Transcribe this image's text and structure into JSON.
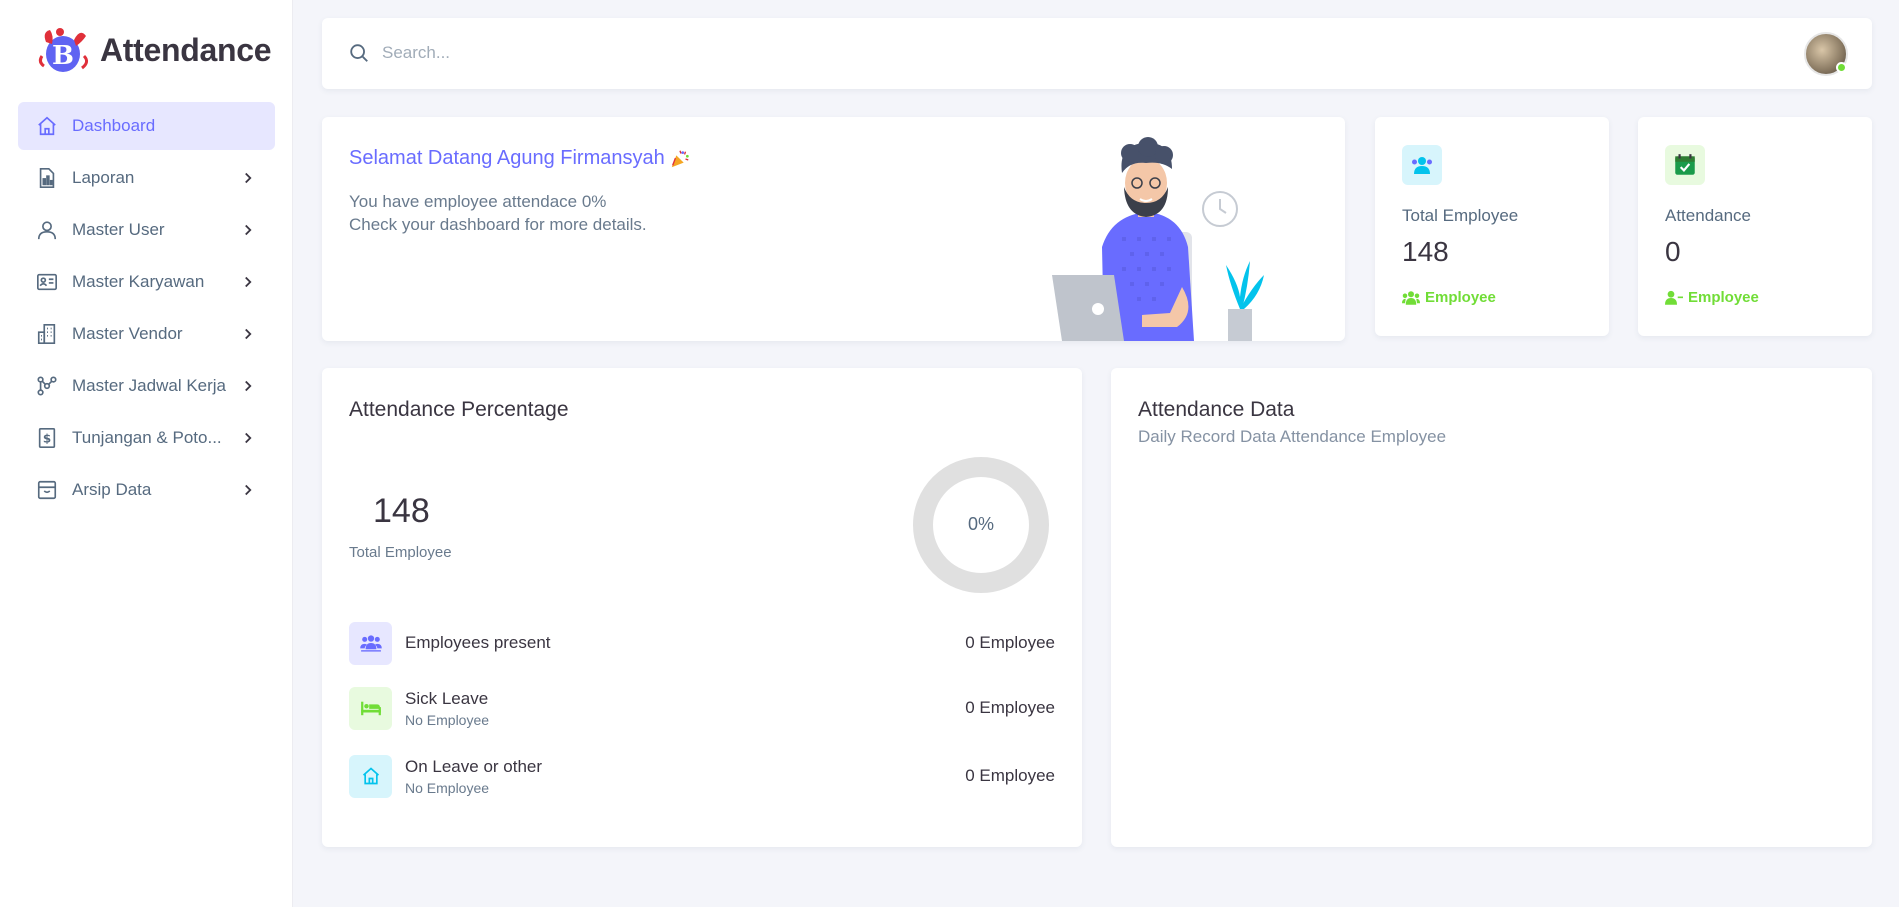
{
  "brand": {
    "title": "Attendance",
    "logo_letter": "B"
  },
  "sidebar": {
    "items": [
      {
        "label": "Dashboard",
        "icon": "home-icon",
        "active": true
      },
      {
        "label": "Laporan",
        "icon": "report-icon"
      },
      {
        "label": "Master User",
        "icon": "user-icon"
      },
      {
        "label": "Master Karyawan",
        "icon": "id-card-icon"
      },
      {
        "label": "Master Vendor",
        "icon": "building-icon"
      },
      {
        "label": "Master Jadwal Kerja",
        "icon": "network-icon"
      },
      {
        "label": "Tunjangan & Poto...",
        "icon": "dollar-receipt-icon"
      },
      {
        "label": "Arsip Data",
        "icon": "archive-icon"
      }
    ]
  },
  "search": {
    "placeholder": "Search..."
  },
  "welcome": {
    "title": "Selamat Datang Agung Firmansyah",
    "line1": "You have employee attendace 0%",
    "line2": "Check your dashboard for more details."
  },
  "stats": [
    {
      "label": "Total Employee",
      "value": "148",
      "footer": "Employee",
      "icon": "users-icon",
      "icon_color": "#03c3ec"
    },
    {
      "label": "Attendance",
      "value": "0",
      "footer": "Employee",
      "icon": "calendar-check-icon",
      "icon_color": "#71dd37"
    }
  ],
  "attendance_percentage": {
    "title": "Attendance Percentage",
    "total_value": "148",
    "total_label": "Total Employee",
    "percent_value": 0,
    "percent_label": "0%",
    "rows": [
      {
        "title": "Employees present",
        "subtitle": "",
        "value": "0 Employee",
        "icon": "group-icon"
      },
      {
        "title": "Sick Leave",
        "subtitle": "No Employee",
        "value": "0 Employee",
        "icon": "bed-icon"
      },
      {
        "title": "On Leave or other",
        "subtitle": "No Employee",
        "value": "0 Employee",
        "icon": "home-icon"
      }
    ]
  },
  "attendance_data": {
    "title": "Attendance Data",
    "subtitle": "Daily Record Data Attendance Employee"
  },
  "colors": {
    "primary": "#696cff",
    "success": "#71dd37",
    "info": "#03c3ec",
    "background": "#f4f5fa"
  }
}
